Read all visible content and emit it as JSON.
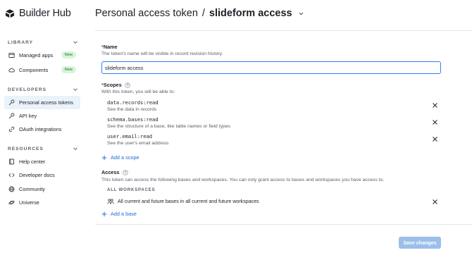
{
  "brand": {
    "name": "Builder Hub",
    "icon": "builder-hub-logo-icon"
  },
  "sidebar": {
    "sections": [
      {
        "title": "LIBRARY",
        "items": [
          {
            "label": "Managed apps",
            "icon": "apps-icon",
            "badge": "New"
          },
          {
            "label": "Components",
            "icon": "cloud-icon",
            "badge": "New"
          }
        ]
      },
      {
        "title": "DEVELOPERS",
        "items": [
          {
            "label": "Personal access tokens",
            "icon": "key-icon",
            "active": true
          },
          {
            "label": "API key",
            "icon": "key-icon"
          },
          {
            "label": "OAuth integrations",
            "icon": "link-icon"
          }
        ]
      },
      {
        "title": "RESOURCES",
        "items": [
          {
            "label": "Help center",
            "icon": "book-icon"
          },
          {
            "label": "Developer docs",
            "icon": "code-icon"
          },
          {
            "label": "Community",
            "icon": "globe-icon"
          },
          {
            "label": "Universe",
            "icon": "universe-icon"
          }
        ]
      }
    ]
  },
  "header": {
    "parent": "Personal access token",
    "separator": "/",
    "current": "slideform access"
  },
  "form": {
    "name": {
      "required_mark": "*",
      "label": "Name",
      "description": "The token's name will be visible in record revision history.",
      "value": "slideform access"
    },
    "scopes": {
      "required_mark": "*",
      "label": "Scopes",
      "description": "With this token, you will be able to:",
      "items": [
        {
          "code": "data.records:read",
          "description": "See the data in records"
        },
        {
          "code": "schema.bases:read",
          "description": "See the structure of a base, like table names or field types"
        },
        {
          "code": "user.email:read",
          "description": "See the user's email address"
        }
      ],
      "add_label": "Add a scope"
    },
    "access": {
      "label": "Access",
      "description": "This token can access the following bases and workspaces. You can only grant access to bases and workspaces you have access to.",
      "group_title": "ALL WORKSPACES",
      "item": "All current and future bases in all current and future workspaces",
      "add_label": "Add a base"
    },
    "save_label": "Save changes"
  },
  "colors": {
    "accent": "#2d7ff9",
    "link": "#1c6cd8",
    "active_nav_bg": "#eaf2fa",
    "badge_bg": "#d6f5d7",
    "save_disabled_bg": "#9bbfe9",
    "required": "#c43c3c"
  }
}
